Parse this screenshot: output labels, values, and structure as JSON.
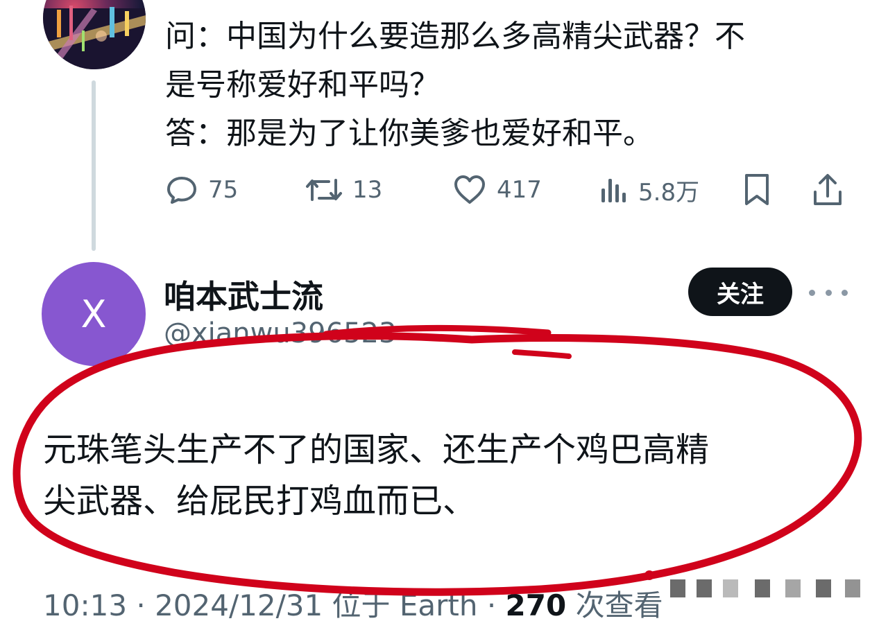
{
  "parent_tweet": {
    "lines": [
      "问：中国为什么要造那么多高精尖武器？不",
      "是号称爱好和平吗？",
      "答：那是为了让你美爹也爱好和平。"
    ],
    "replies": "75",
    "reposts": "13",
    "likes": "417",
    "views": "5.8万"
  },
  "reply_tweet": {
    "avatar_letter": "X",
    "display_name": "咱本武士流",
    "handle": "@xianwu396523",
    "follow_label": "关注",
    "lines": [
      "元珠笔头生产不了的国家、还生产个鸡巴高精",
      "尖武器、给屁民打鸡血而已、"
    ],
    "time": "10:13 · 2024/12/31 位于 Earth · ",
    "view_count": "270",
    "view_suffix": " 次查看"
  },
  "colors": {
    "text_primary": "#0f1419",
    "text_secondary": "#536471",
    "follow_bg": "#0f1419",
    "avatar_x": "#8757d0",
    "annotation_red": "#d0021b"
  },
  "icons": {
    "reply": "comment-icon",
    "repost": "repost-icon",
    "like": "heart-icon",
    "views": "bar-chart-icon",
    "bookmark": "bookmark-icon",
    "share": "share-icon",
    "more": "more-dots-icon"
  }
}
